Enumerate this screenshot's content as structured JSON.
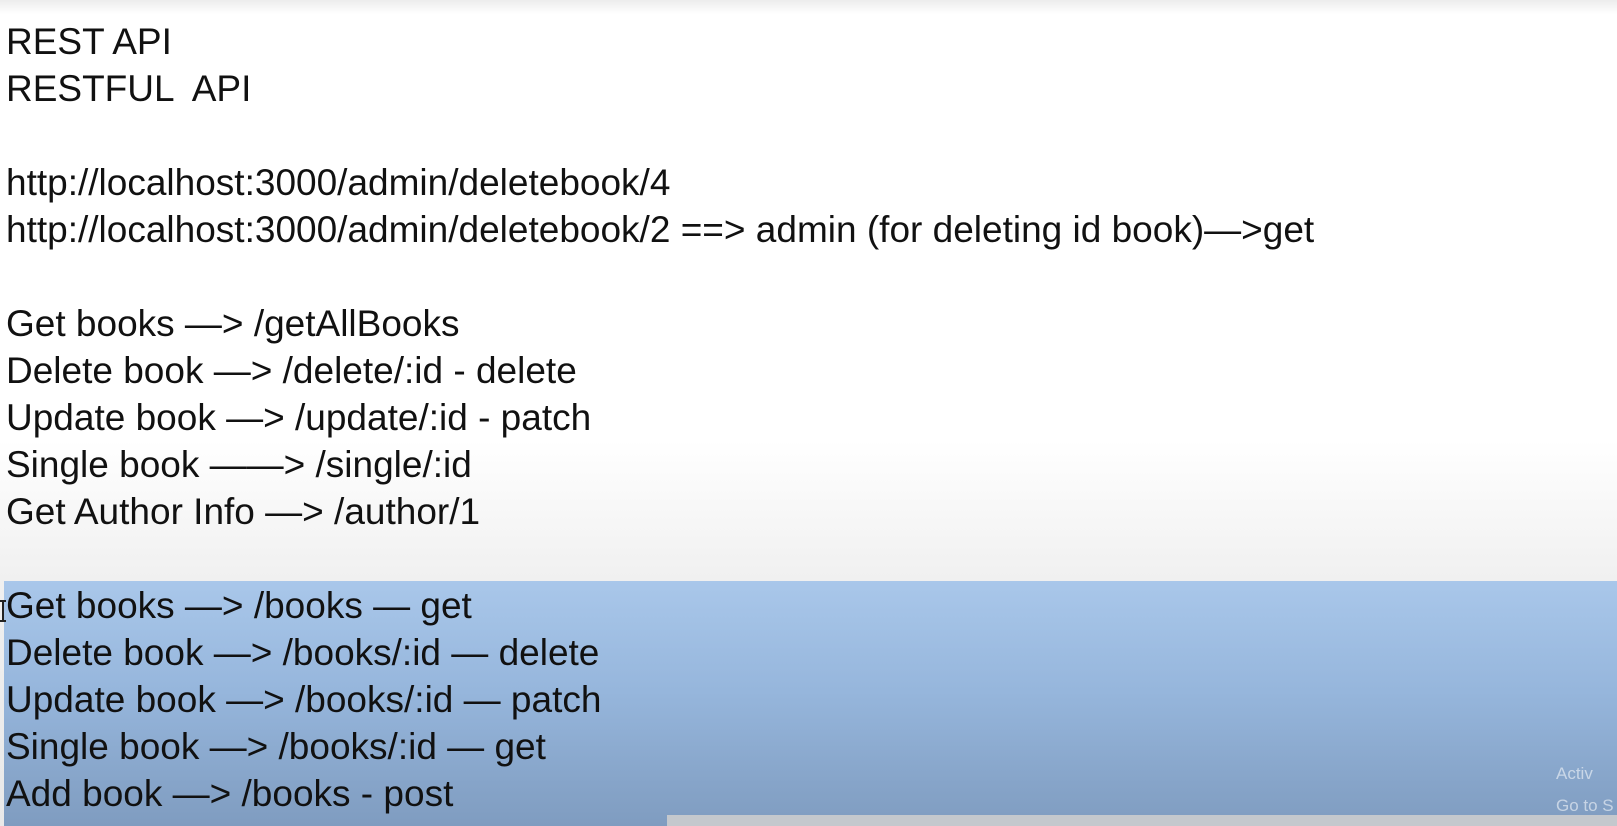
{
  "document": {
    "lines": [
      "REST API",
      "RESTFUL  API",
      "http://localhost:3000/admin/deletebook/4",
      "http://localhost:3000/admin/deletebook/2 ==> admin (for deleting id book)—>get",
      "Get books —> /getAllBooks",
      "Delete book —> /delete/:id - delete",
      "Update book —> /update/:id - patch",
      "Single book ——> /single/:id",
      "Get Author Info —> /author/1"
    ],
    "selected_lines": [
      "Get books —> /books — get",
      "Delete book —> /books/:id — delete",
      "Update book —> /books/:id — patch",
      "Single book —> /books/:id — get",
      "Add book —> /books - post"
    ]
  },
  "watermark": {
    "line1": "Activ",
    "line2": "Go to S"
  },
  "colors": {
    "text": "#111111",
    "selection_top": "#a9c7ea",
    "selection_bottom": "#7f9cc0",
    "scrollbar": "#c4c8cd"
  }
}
